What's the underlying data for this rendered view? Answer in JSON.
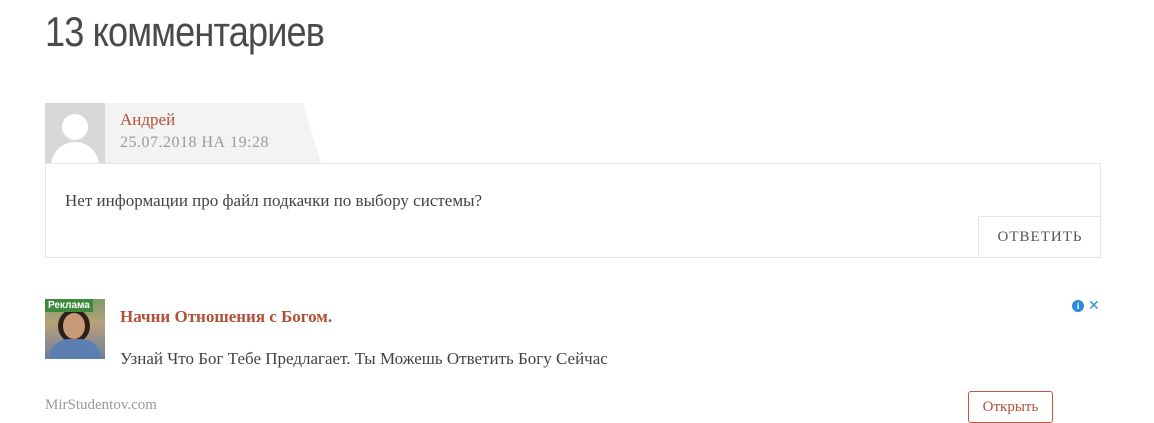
{
  "comments": {
    "heading": "13 комментариев",
    "items": [
      {
        "author": "Андрей",
        "date": "25.07.2018 НА 19:28",
        "text": "Нет информации про файл подкачки по выбору системы?",
        "reply_label": "ОТВЕТИТЬ"
      }
    ]
  },
  "ad": {
    "badge": "Реклама",
    "title": "Начни Отношения с Богом.",
    "description": "Узнай Что Бог Тебе Предлагает. Ты Можешь Ответить Богу Сейчас",
    "domain": "MirStudentov.com",
    "open_label": "Открыть",
    "info_icon": "info-icon",
    "close_icon": "close-icon"
  },
  "colors": {
    "accent": "#b0513a",
    "ad_badge": "#3d8a3d",
    "ad_info": "#2a8cd8"
  }
}
